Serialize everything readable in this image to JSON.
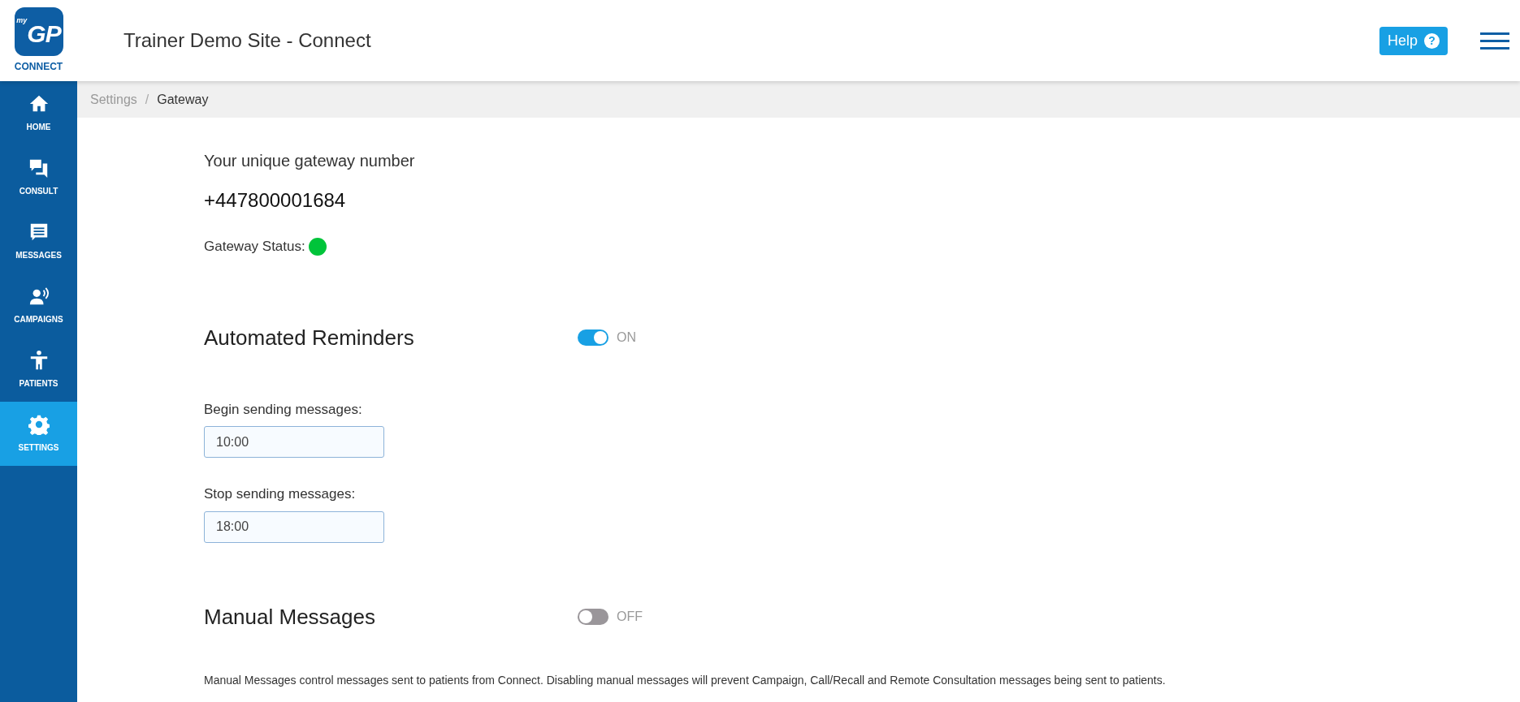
{
  "logo": {
    "prefix": "my",
    "mark": "GP",
    "caption": "CONNECT"
  },
  "header": {
    "title": "Trainer Demo Site - Connect",
    "help_button": "Help",
    "help_icon": "?"
  },
  "sidebar": {
    "items": [
      {
        "kind": "home",
        "label": "HOME",
        "selected": false
      },
      {
        "kind": "consult",
        "label": "CONSULT",
        "selected": false
      },
      {
        "kind": "messages",
        "label": "MESSAGES",
        "selected": false
      },
      {
        "kind": "campaigns",
        "label": "CAMPAIGNS",
        "selected": false
      },
      {
        "kind": "patients",
        "label": "PATIENTS",
        "selected": false
      },
      {
        "kind": "settings",
        "label": "SETTINGS",
        "selected": true
      }
    ]
  },
  "breadcrumb": {
    "items": [
      "Settings",
      "Gateway"
    ],
    "separator": "/"
  },
  "gateway": {
    "heading": "Your unique gateway number",
    "number": "+447800001684",
    "status": {
      "label": "Gateway Status:",
      "color": "#00c43a"
    }
  },
  "automated_reminders": {
    "title": "Automated Reminders",
    "on": true,
    "state_label": "ON",
    "fields": [
      {
        "label": "Begin sending messages:",
        "value": "10:00"
      },
      {
        "label": "Stop sending messages:",
        "value": "18:00"
      }
    ]
  },
  "manual_messages": {
    "title": "Manual Messages",
    "on": false,
    "state_label": "OFF",
    "note": "Manual Messages control messages sent to patients from Connect. Disabling manual messages will prevent Campaign, Call/Recall and Remote Consultation messages being sent to patients."
  }
}
